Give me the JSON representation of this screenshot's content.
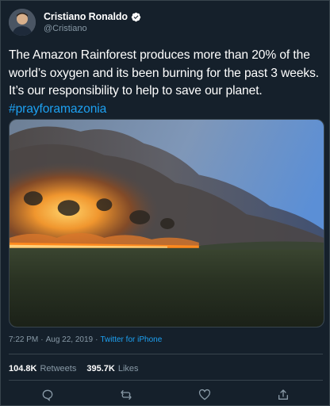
{
  "user": {
    "display_name": "Cristiano Ronaldo",
    "handle": "@Cristiano",
    "verified": true,
    "verified_icon": "verified-badge-icon"
  },
  "tweet": {
    "text": "The Amazon Rainforest produces more than 20% of the world’s oxygen and its been burning for the past 3 weeks. It’s our responsibility to help to save our planet.",
    "hashtag": "#prayforamazonia"
  },
  "meta": {
    "time": "7:22 PM",
    "separator": "·",
    "date": "Aug 22, 2019",
    "source": "Twitter for iPhone"
  },
  "stats": {
    "retweets_count": "104.8K",
    "retweets_label": "Retweets",
    "likes_count": "395.7K",
    "likes_label": "Likes"
  },
  "actions": [
    {
      "name": "reply",
      "icon": "reply-icon"
    },
    {
      "name": "retweet",
      "icon": "retweet-icon"
    },
    {
      "name": "like",
      "icon": "heart-icon"
    },
    {
      "name": "share",
      "icon": "share-icon"
    }
  ],
  "colors": {
    "background": "#15202b",
    "border": "#38444d",
    "text_primary": "#ffffff",
    "text_secondary": "#8899a6",
    "accent": "#1da1f2"
  }
}
